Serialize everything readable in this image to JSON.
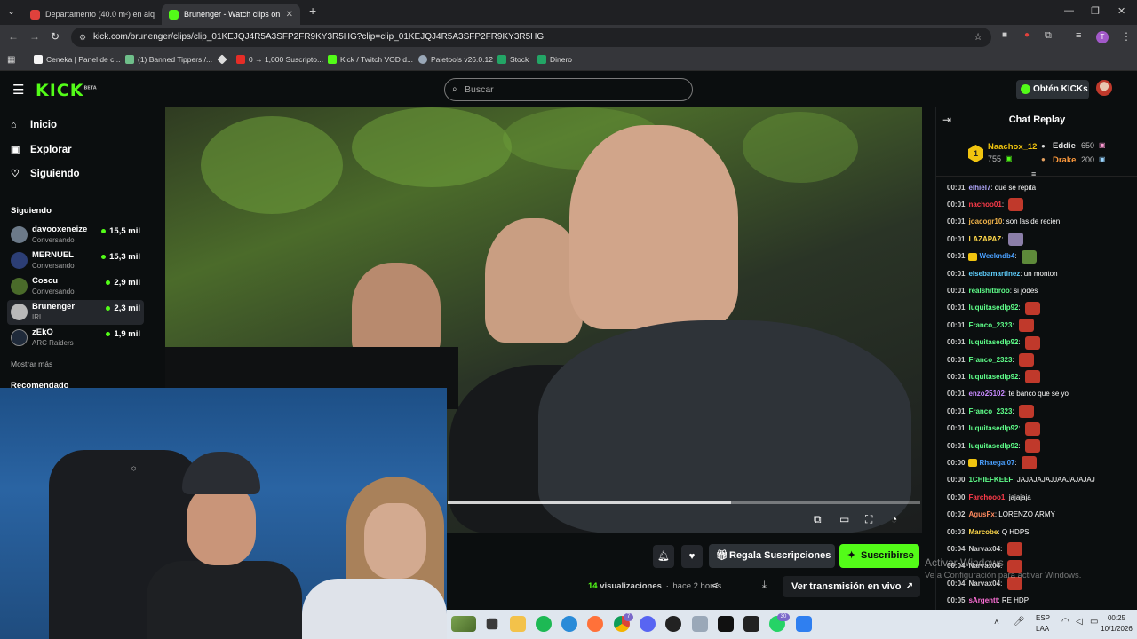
{
  "browser": {
    "tabs": [
      {
        "title": "Departamento (40.0 m²) en alq",
        "active": false
      },
      {
        "title": "Brunenger - Watch clips on",
        "active": true
      }
    ],
    "url": "kick.com/brunenger/clips/clip_01KEJQJ4R5A3SFP2FR9KY3R5HG?clip=clip_01KEJQJ4R5A3SFP2FR9KY3R5HG",
    "profile_initial": "T",
    "bookmarks": [
      "Ceneka | Panel de c...",
      "(1) Banned Tippers /...",
      "0 → 1,000 Suscripto...",
      "Kick / Twitch VOD d...",
      "Paletools v26.0.12",
      "Stock",
      "Dinero"
    ]
  },
  "header": {
    "logo": "KICK",
    "logo_tag": "BETA",
    "search_placeholder": "Buscar",
    "kicks_button": "Obtén KICKs"
  },
  "sidebar": {
    "nav": [
      {
        "label": "Inicio",
        "icon": "home-icon"
      },
      {
        "label": "Explorar",
        "icon": "compass-icon"
      },
      {
        "label": "Siguiendo",
        "icon": "heart-icon"
      }
    ],
    "following_title": "Siguiendo",
    "channels": [
      {
        "name": "davooxeneize",
        "category": "Conversando",
        "viewers": "15,5 mil",
        "color": "#6c7a89"
      },
      {
        "name": "MERNUEL",
        "category": "Conversando",
        "viewers": "15,3 mil",
        "color": "#2c3e75"
      },
      {
        "name": "Coscu",
        "category": "Conversando",
        "viewers": "2,9 mil",
        "color": "#4a6b2a"
      },
      {
        "name": "Brunenger",
        "category": "IRL",
        "viewers": "2,3 mil",
        "color": "#b9b9b9"
      },
      {
        "name": "zEkO",
        "category": "ARC Raiders",
        "viewers": "1,9 mil",
        "color": "#1f2a3a"
      }
    ],
    "show_more": "Mostrar más",
    "recommended_title": "Recomendado"
  },
  "actions": {
    "gift_subs": "Regala Suscripciones",
    "subscribe": "Suscribirse",
    "views_count": "14",
    "views_label": "visualizaciones",
    "time_ago": "hace 2 horas",
    "watch_live": "Ver transmisión en vivo"
  },
  "windows_watermark": {
    "title": "Activar Windows",
    "subtitle": "Ve a Configuración para activar Windows."
  },
  "chat": {
    "title": "Chat Replay",
    "leaderboard": {
      "rank": "1",
      "top": {
        "name": "Naachox_12",
        "value": "755"
      },
      "second": {
        "name": "Eddie",
        "value": "650"
      },
      "third": {
        "name": "Drake",
        "value": "200"
      }
    },
    "messages": [
      {
        "time": "00:01",
        "user": "elhiel7",
        "color": "#b3a9ff",
        "text": "que se repita",
        "emote": ""
      },
      {
        "time": "00:01",
        "user": "nachoo01",
        "color": "#ff3b4a",
        "text": "",
        "emote": "red"
      },
      {
        "time": "00:01",
        "user": "joacogr10",
        "color": "#f0b34a",
        "text": "son las de recien",
        "emote": ""
      },
      {
        "time": "00:01",
        "user": "LAZAPAZ",
        "color": "#ffd84a",
        "text": "",
        "emote": "purple"
      },
      {
        "time": "00:01",
        "user": "Weekndb4",
        "color": "#4aa0ff",
        "text": "",
        "emote": "green",
        "badge": true
      },
      {
        "time": "00:01",
        "user": "elsebamartinez",
        "color": "#5fd0ff",
        "text": "un monton",
        "emote": ""
      },
      {
        "time": "00:01",
        "user": "realshitbroo",
        "color": "#5fff8a",
        "text": "si jodes",
        "emote": ""
      },
      {
        "time": "00:01",
        "user": "luquitasedlp92",
        "color": "#5fff8a",
        "text": "",
        "emote": "red"
      },
      {
        "time": "00:01",
        "user": "Franco_2323",
        "color": "#5fff8a",
        "text": "",
        "emote": "red"
      },
      {
        "time": "00:01",
        "user": "luquitasedlp92",
        "color": "#5fff8a",
        "text": "",
        "emote": "red"
      },
      {
        "time": "00:01",
        "user": "Franco_2323",
        "color": "#5fff8a",
        "text": "",
        "emote": "red"
      },
      {
        "time": "00:01",
        "user": "luquitasedlp92",
        "color": "#5fff8a",
        "text": "",
        "emote": "red"
      },
      {
        "time": "00:01",
        "user": "enzo25102",
        "color": "#c88aff",
        "text": "te banco que se yo",
        "emote": ""
      },
      {
        "time": "00:01",
        "user": "Franco_2323",
        "color": "#5fff8a",
        "text": "",
        "emote": "red"
      },
      {
        "time": "00:01",
        "user": "luquitasedlp92",
        "color": "#5fff8a",
        "text": "",
        "emote": "red"
      },
      {
        "time": "00:01",
        "user": "luquitasedlp92",
        "color": "#5fff8a",
        "text": "",
        "emote": "red"
      },
      {
        "time": "00:00",
        "user": "Rhaegal07",
        "color": "#4aa0ff",
        "text": "",
        "emote": "red",
        "badge": true
      },
      {
        "time": "00:00",
        "user": "1CHIEFKEEF",
        "color": "#5fff8a",
        "text": "JAJAJAJAJJAAJAJAJAJ",
        "emote": ""
      },
      {
        "time": "00:00",
        "user": "Farchooo1",
        "color": "#ff3b4a",
        "text": "jajajaja",
        "emote": ""
      },
      {
        "time": "00:02",
        "user": "AgusFx",
        "color": "#ff8a5f",
        "text": "LORENZO ARMY",
        "emote": ""
      },
      {
        "time": "00:03",
        "user": "Marcobe",
        "color": "#ffd84a",
        "text": "Q HDPS",
        "emote": ""
      },
      {
        "time": "00:04",
        "user": "Narvax04",
        "color": "#cfcfcf",
        "text": "",
        "emote": "red"
      },
      {
        "time": "00:04",
        "user": "Narvax04",
        "color": "#cfcfcf",
        "text": "",
        "emote": "red"
      },
      {
        "time": "00:04",
        "user": "Narvax04",
        "color": "#cfcfcf",
        "text": "",
        "emote": "red"
      },
      {
        "time": "00:05",
        "user": "sArgentt",
        "color": "#ff6fd8",
        "text": "RE HDP",
        "emote": ""
      }
    ]
  },
  "taskbar": {
    "lang": "ESP",
    "lang2": "LAA",
    "time": "00:25",
    "date": "10/1/2026",
    "badge_a": "7",
    "badge_b": "30"
  }
}
